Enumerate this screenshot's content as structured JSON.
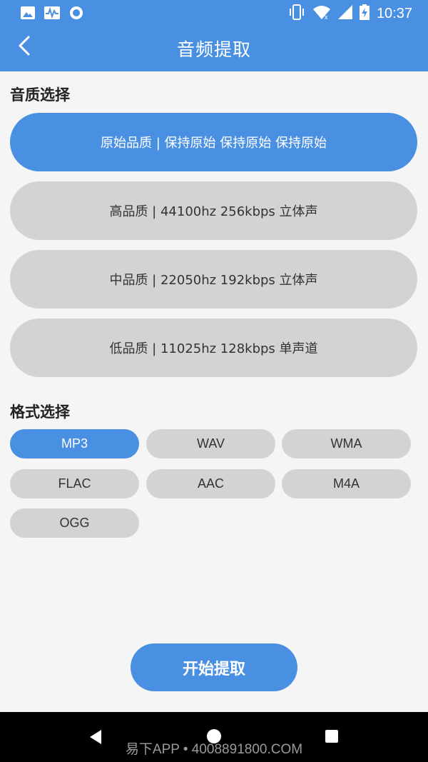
{
  "status_bar": {
    "time": "10:37",
    "left_icons": [
      "image-icon",
      "pulse-icon",
      "circle-icon"
    ],
    "right_icons": [
      "vibrate-icon",
      "wifi-icon",
      "signal-icon",
      "battery-icon"
    ]
  },
  "header": {
    "title": "音频提取",
    "back_icon": "chevron-left-icon",
    "color": "#4a90e2"
  },
  "quality": {
    "section_title": "音质选择",
    "selected_index": 0,
    "options": [
      {
        "label": "原始品质 | 保持原始 保持原始 保持原始"
      },
      {
        "label": "高品质 | 44100hz 256kbps 立体声"
      },
      {
        "label": "中品质 | 22050hz 192kbps 立体声"
      },
      {
        "label": "低品质 | 11025hz 128kbps 单声道"
      }
    ]
  },
  "format": {
    "section_title": "格式选择",
    "selected_index": 0,
    "options": [
      "MP3",
      "WAV",
      "WMA",
      "FLAC",
      "AAC",
      "M4A",
      "OGG"
    ]
  },
  "actions": {
    "start_label": "开始提取"
  },
  "watermark": "易下APP • 4008891800.COM",
  "colors": {
    "accent": "#4a90e2",
    "unselected": "#d3d3d3",
    "background": "#f5f5f5"
  }
}
